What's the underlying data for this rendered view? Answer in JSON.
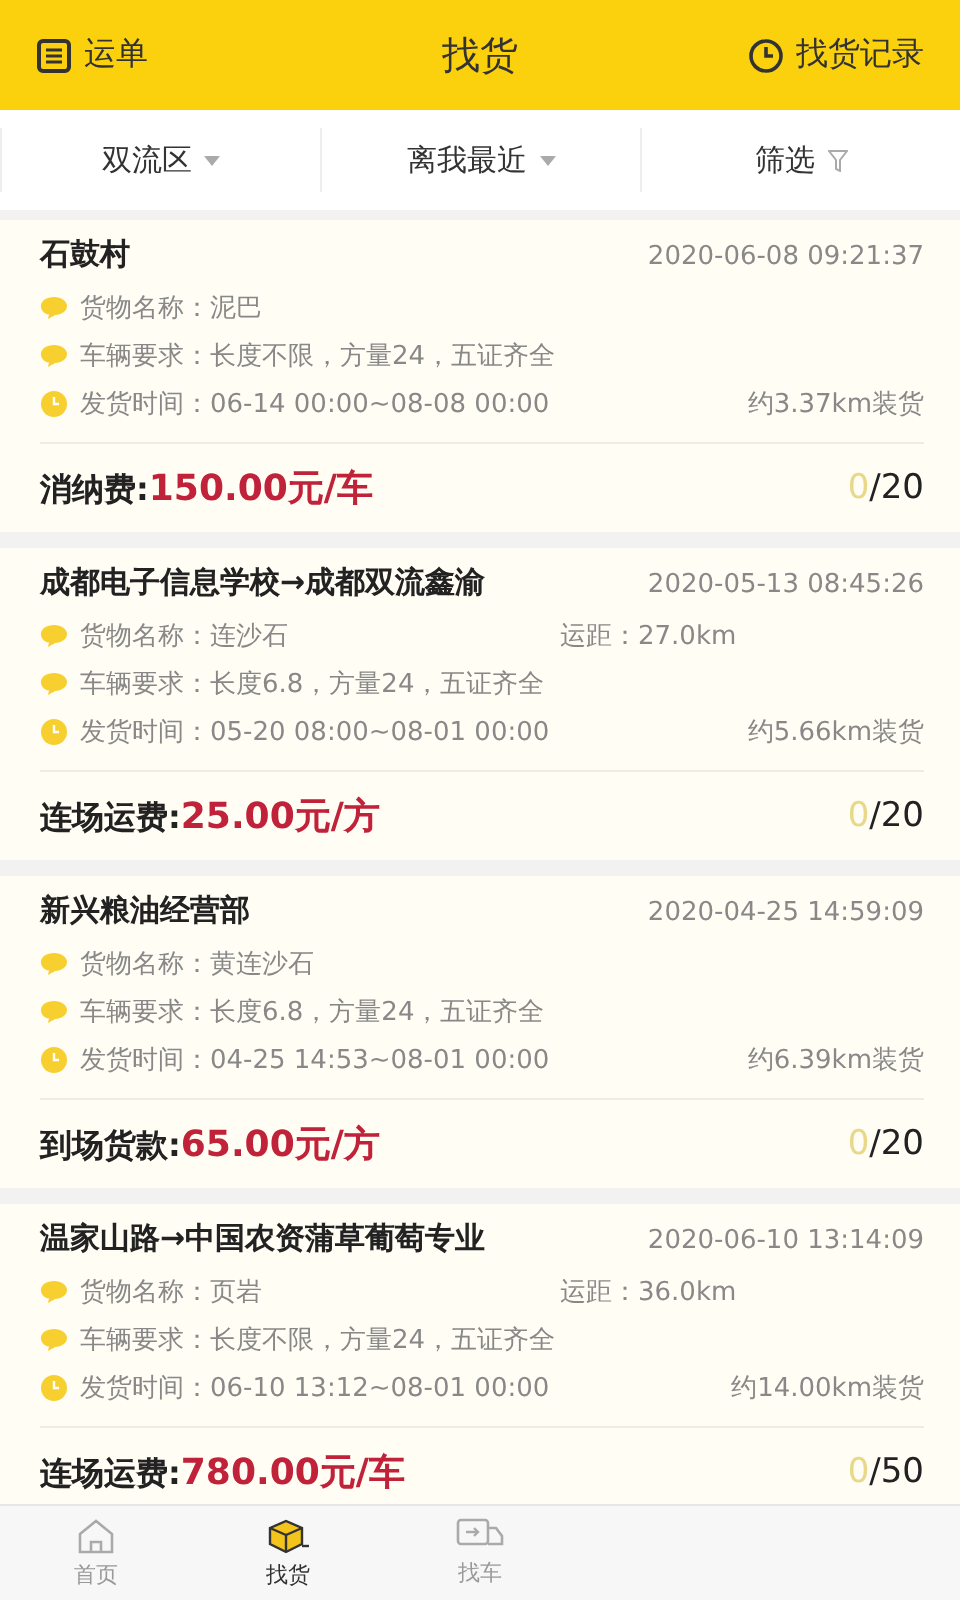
{
  "header": {
    "left": "运单",
    "title": "找货",
    "right": "找货记录"
  },
  "filters": [
    {
      "label": "双流区",
      "kind": "dropdown"
    },
    {
      "label": "离我最近",
      "kind": "dropdown"
    },
    {
      "label": "筛选",
      "kind": "filter"
    }
  ],
  "cards": [
    {
      "title": "石鼓村",
      "time": "2020-06-08 09:21:37",
      "rows": [
        {
          "kind": "chat",
          "text": "货物名称：泥巴"
        },
        {
          "kind": "chat",
          "text": "车辆要求：长度不限，方量24，五证齐全"
        },
        {
          "kind": "clock",
          "text": "发货时间：06-14 00:00~08-08 00:00",
          "extra": "约3.37km装货"
        }
      ],
      "fee_label": "消纳费:",
      "price": "150.00元/车",
      "taken": "0",
      "limit": "/20"
    },
    {
      "title": "成都电子信息学校→成都双流鑫渝",
      "time": "2020-05-13 08:45:26",
      "rows": [
        {
          "kind": "chat",
          "text": "货物名称：连沙石",
          "middle": "运距：27.0km"
        },
        {
          "kind": "chat",
          "text": "车辆要求：长度6.8，方量24，五证齐全"
        },
        {
          "kind": "clock",
          "text": "发货时间：05-20 08:00~08-01 00:00",
          "extra": "约5.66km装货"
        }
      ],
      "fee_label": "连场运费:",
      "price": "25.00元/方",
      "taken": "0",
      "limit": "/20"
    },
    {
      "title": "新兴粮油经营部",
      "time": "2020-04-25 14:59:09",
      "rows": [
        {
          "kind": "chat",
          "text": "货物名称：黄连沙石"
        },
        {
          "kind": "chat",
          "text": "车辆要求：长度6.8，方量24，五证齐全"
        },
        {
          "kind": "clock",
          "text": "发货时间：04-25 14:53~08-01 00:00",
          "extra": "约6.39km装货"
        }
      ],
      "fee_label": "到场货款:",
      "price": "65.00元/方",
      "taken": "0",
      "limit": "/20"
    },
    {
      "title": "温家山路→中国农资蒲草葡萄专业",
      "time": "2020-06-10 13:14:09",
      "rows": [
        {
          "kind": "chat",
          "text": "货物名称：页岩",
          "middle": "运距：36.0km"
        },
        {
          "kind": "chat",
          "text": "车辆要求：长度不限，方量24，五证齐全"
        },
        {
          "kind": "clock",
          "text": "发货时间：06-10 13:12~08-01 00:00",
          "extra": "约14.00km装货"
        }
      ],
      "fee_label": "连场运费:",
      "price": "780.00元/车",
      "taken": "0",
      "limit": "/50"
    }
  ],
  "tabs": [
    {
      "label": "首页",
      "kind": "home",
      "selected": false
    },
    {
      "label": "找货",
      "kind": "box",
      "selected": true
    },
    {
      "label": "找车",
      "kind": "truck",
      "selected": false
    }
  ]
}
